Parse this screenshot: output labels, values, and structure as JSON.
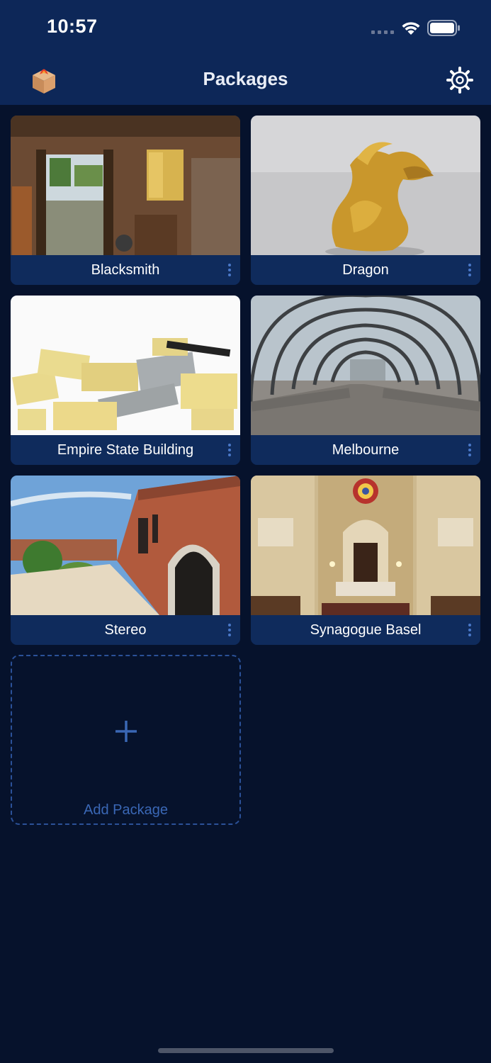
{
  "status_bar": {
    "time": "10:57",
    "icons": [
      "cellular-signal-icon",
      "wifi-icon",
      "battery-icon"
    ]
  },
  "nav": {
    "title": "Packages",
    "left_icon": "package-box-icon",
    "right_icon": "settings-gear-icon"
  },
  "packages": [
    {
      "name": "Blacksmith",
      "thumbnail": "blacksmith workshop interior"
    },
    {
      "name": "Dragon",
      "thumbnail": "golden dragon statue"
    },
    {
      "name": "Empire State Building",
      "thumbnail": "pile of tan and gray bricks"
    },
    {
      "name": "Melbourne",
      "thumbnail": "arched footbridge"
    },
    {
      "name": "Stereo",
      "thumbnail": "brick building with arched doorway"
    },
    {
      "name": "Synagogue Basel",
      "thumbnail": "synagogue interior"
    }
  ],
  "add_package": {
    "label": "Add Package",
    "icon": "plus-icon"
  },
  "colors": {
    "background": "#06122c",
    "header": "#0d2758",
    "card_caption": "#0f2b5c",
    "accent": "#3a67b5"
  }
}
